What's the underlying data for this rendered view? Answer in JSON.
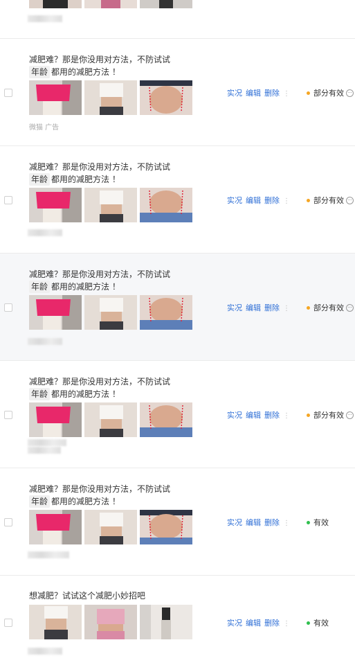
{
  "title_line1": "减肥难？那是你没用对方法，不防试试",
  "tag": "年龄",
  "title_line2": "都用的减肥方法 ！",
  "title_alt": "想减肥？试试这个减肥小妙招吧",
  "actions": {
    "preview": "实况",
    "edit": "编辑",
    "delete": "删除",
    "more": "⋮"
  },
  "status": {
    "partial": "部分有效",
    "valid": "有效"
  },
  "colors": {
    "partial": "#f5a623",
    "valid": "#2fbf4e",
    "link": "#2f6fd6"
  },
  "rows": [
    {
      "subtitle": ""
    },
    {
      "subtitle": "微猫 广告",
      "status": "partial"
    },
    {
      "subtitle": "",
      "status": "partial"
    },
    {
      "subtitle": "",
      "status": "partial"
    },
    {
      "subtitle": "",
      "status": "partial"
    },
    {
      "subtitle": "",
      "status": "valid"
    },
    {
      "subtitle": "",
      "status": "valid"
    }
  ]
}
